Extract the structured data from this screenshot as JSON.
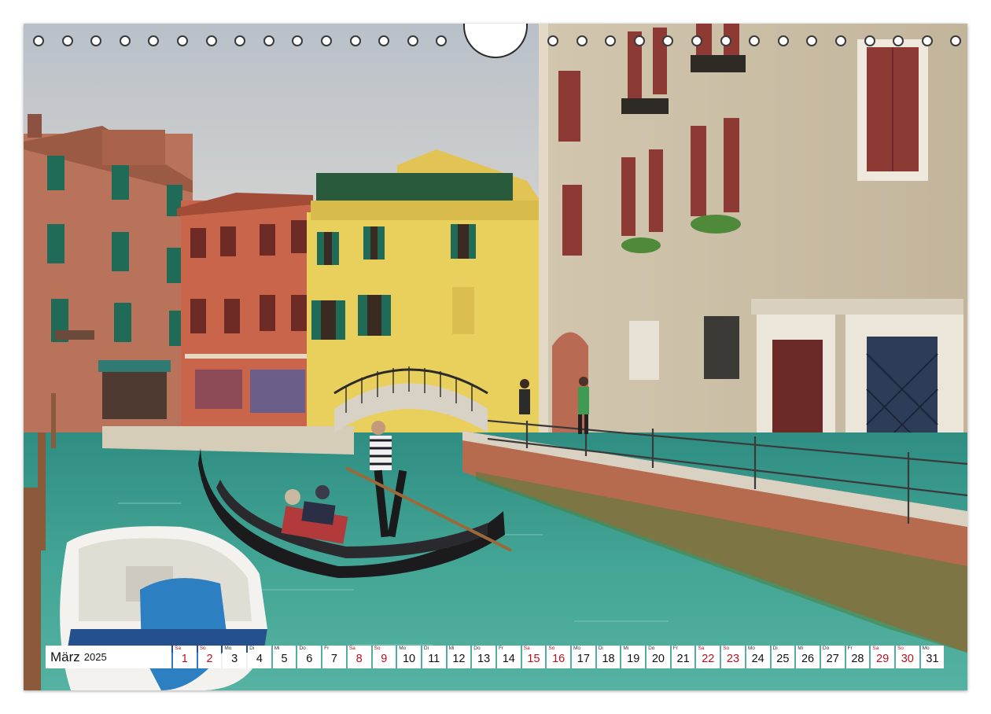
{
  "calendar": {
    "month": "März",
    "year": "2025",
    "days": [
      {
        "wd": "Sa",
        "num": "1",
        "weekend": true
      },
      {
        "wd": "So",
        "num": "2",
        "weekend": true
      },
      {
        "wd": "Mo",
        "num": "3",
        "weekend": false
      },
      {
        "wd": "Di",
        "num": "4",
        "weekend": false
      },
      {
        "wd": "Mi",
        "num": "5",
        "weekend": false
      },
      {
        "wd": "Do",
        "num": "6",
        "weekend": false
      },
      {
        "wd": "Fr",
        "num": "7",
        "weekend": false
      },
      {
        "wd": "Sa",
        "num": "8",
        "weekend": true
      },
      {
        "wd": "So",
        "num": "9",
        "weekend": true
      },
      {
        "wd": "Mo",
        "num": "10",
        "weekend": false
      },
      {
        "wd": "Di",
        "num": "11",
        "weekend": false
      },
      {
        "wd": "Mi",
        "num": "12",
        "weekend": false
      },
      {
        "wd": "Do",
        "num": "13",
        "weekend": false
      },
      {
        "wd": "Fr",
        "num": "14",
        "weekend": false
      },
      {
        "wd": "Sa",
        "num": "15",
        "weekend": true
      },
      {
        "wd": "So",
        "num": "16",
        "weekend": true
      },
      {
        "wd": "Mo",
        "num": "17",
        "weekend": false
      },
      {
        "wd": "Di",
        "num": "18",
        "weekend": false
      },
      {
        "wd": "Mi",
        "num": "19",
        "weekend": false
      },
      {
        "wd": "Do",
        "num": "20",
        "weekend": false
      },
      {
        "wd": "Fr",
        "num": "21",
        "weekend": false
      },
      {
        "wd": "Sa",
        "num": "22",
        "weekend": true
      },
      {
        "wd": "So",
        "num": "23",
        "weekend": true
      },
      {
        "wd": "Mo",
        "num": "24",
        "weekend": false
      },
      {
        "wd": "Di",
        "num": "25",
        "weekend": false
      },
      {
        "wd": "Mi",
        "num": "26",
        "weekend": false
      },
      {
        "wd": "Do",
        "num": "27",
        "weekend": false
      },
      {
        "wd": "Fr",
        "num": "28",
        "weekend": false
      },
      {
        "wd": "Sa",
        "num": "29",
        "weekend": true
      },
      {
        "wd": "So",
        "num": "30",
        "weekend": true
      },
      {
        "wd": "Mo",
        "num": "31",
        "weekend": false
      }
    ]
  },
  "colors": {
    "weekend_text": "#b3121f",
    "canal_water": "#3f9e8e",
    "yellow_house": "#e9cf5c",
    "red_house": "#c9654a",
    "brick_house": "#c07a5a",
    "palazzo_wall": "#cdbfa6",
    "shutter_green": "#1f6b57",
    "shutter_red": "#8e3a34"
  },
  "photo": {
    "icons": [
      "gondola-icon",
      "gondolier-icon",
      "bridge-icon",
      "motorboat-icon"
    ]
  }
}
